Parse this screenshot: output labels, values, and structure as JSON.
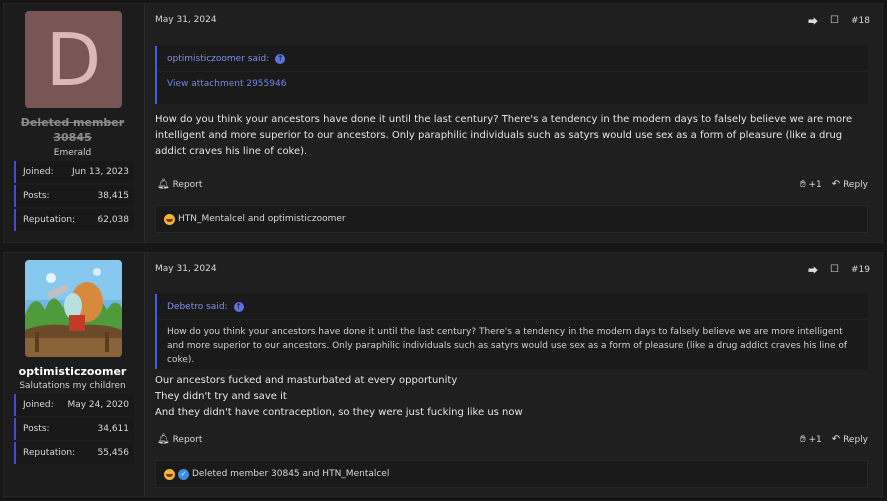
{
  "posts": [
    {
      "user": {
        "avatar_letter": "D",
        "avatar_color": "#7a5555",
        "name": "Deleted member 30845",
        "name_line1": "Deleted member",
        "name_line2": "30845",
        "title": "Emerald",
        "stats": [
          {
            "label": "Joined:",
            "value": "Jun 13, 2023"
          },
          {
            "label": "Posts:",
            "value": "38,415"
          },
          {
            "label": "Reputation:",
            "value": "62,038"
          }
        ]
      },
      "date": "May 31, 2024",
      "number": "#18",
      "quote": {
        "author": "optimisticzoomer said:",
        "link": "View attachment 2955946"
      },
      "message": "How do you think your ancestors have done it until the last century? There's a tendency in the modern days to falsely believe we are more intelligent and more superior to our ancestors. Only paraphilic individuals such as satyrs would use sex as a form of pleasure (like a drug addict craves his line of coke).",
      "report_label": "Report",
      "like_count": "+1",
      "reply_label": "Reply",
      "reactions_text": "HTN_Mentalcel and optimisticzoomer"
    },
    {
      "user": {
        "name": "optimisticzoomer",
        "title": "Salutations my children",
        "stats": [
          {
            "label": "Joined:",
            "value": "May 24, 2020"
          },
          {
            "label": "Posts:",
            "value": "34,611"
          },
          {
            "label": "Reputation:",
            "value": "55,456"
          }
        ]
      },
      "date": "May 31, 2024",
      "number": "#19",
      "quote": {
        "author": "Debetro said:",
        "text": "How do you think your ancestors have done it until the last century? There's a tendency in the modern days to falsely believe we are more intelligent and more superior to our ancestors. Only paraphilic individuals such as satyrs would use sex as a form of pleasure (like a drug addict craves his line of coke)."
      },
      "message_lines": [
        "Our ancestors fucked and masturbated at every opportunity",
        "They didn't try and save it",
        "And they didn't have contraception, so they were just fucking like us now"
      ],
      "report_label": "Report",
      "like_count": "+1",
      "reply_label": "Reply",
      "reactions_text": "Deleted member 30845 and HTN_Mentalcel"
    }
  ],
  "colors": {
    "accent": "#3e5fe0",
    "quote_author": "#7f8fe8",
    "background": "#161616"
  }
}
